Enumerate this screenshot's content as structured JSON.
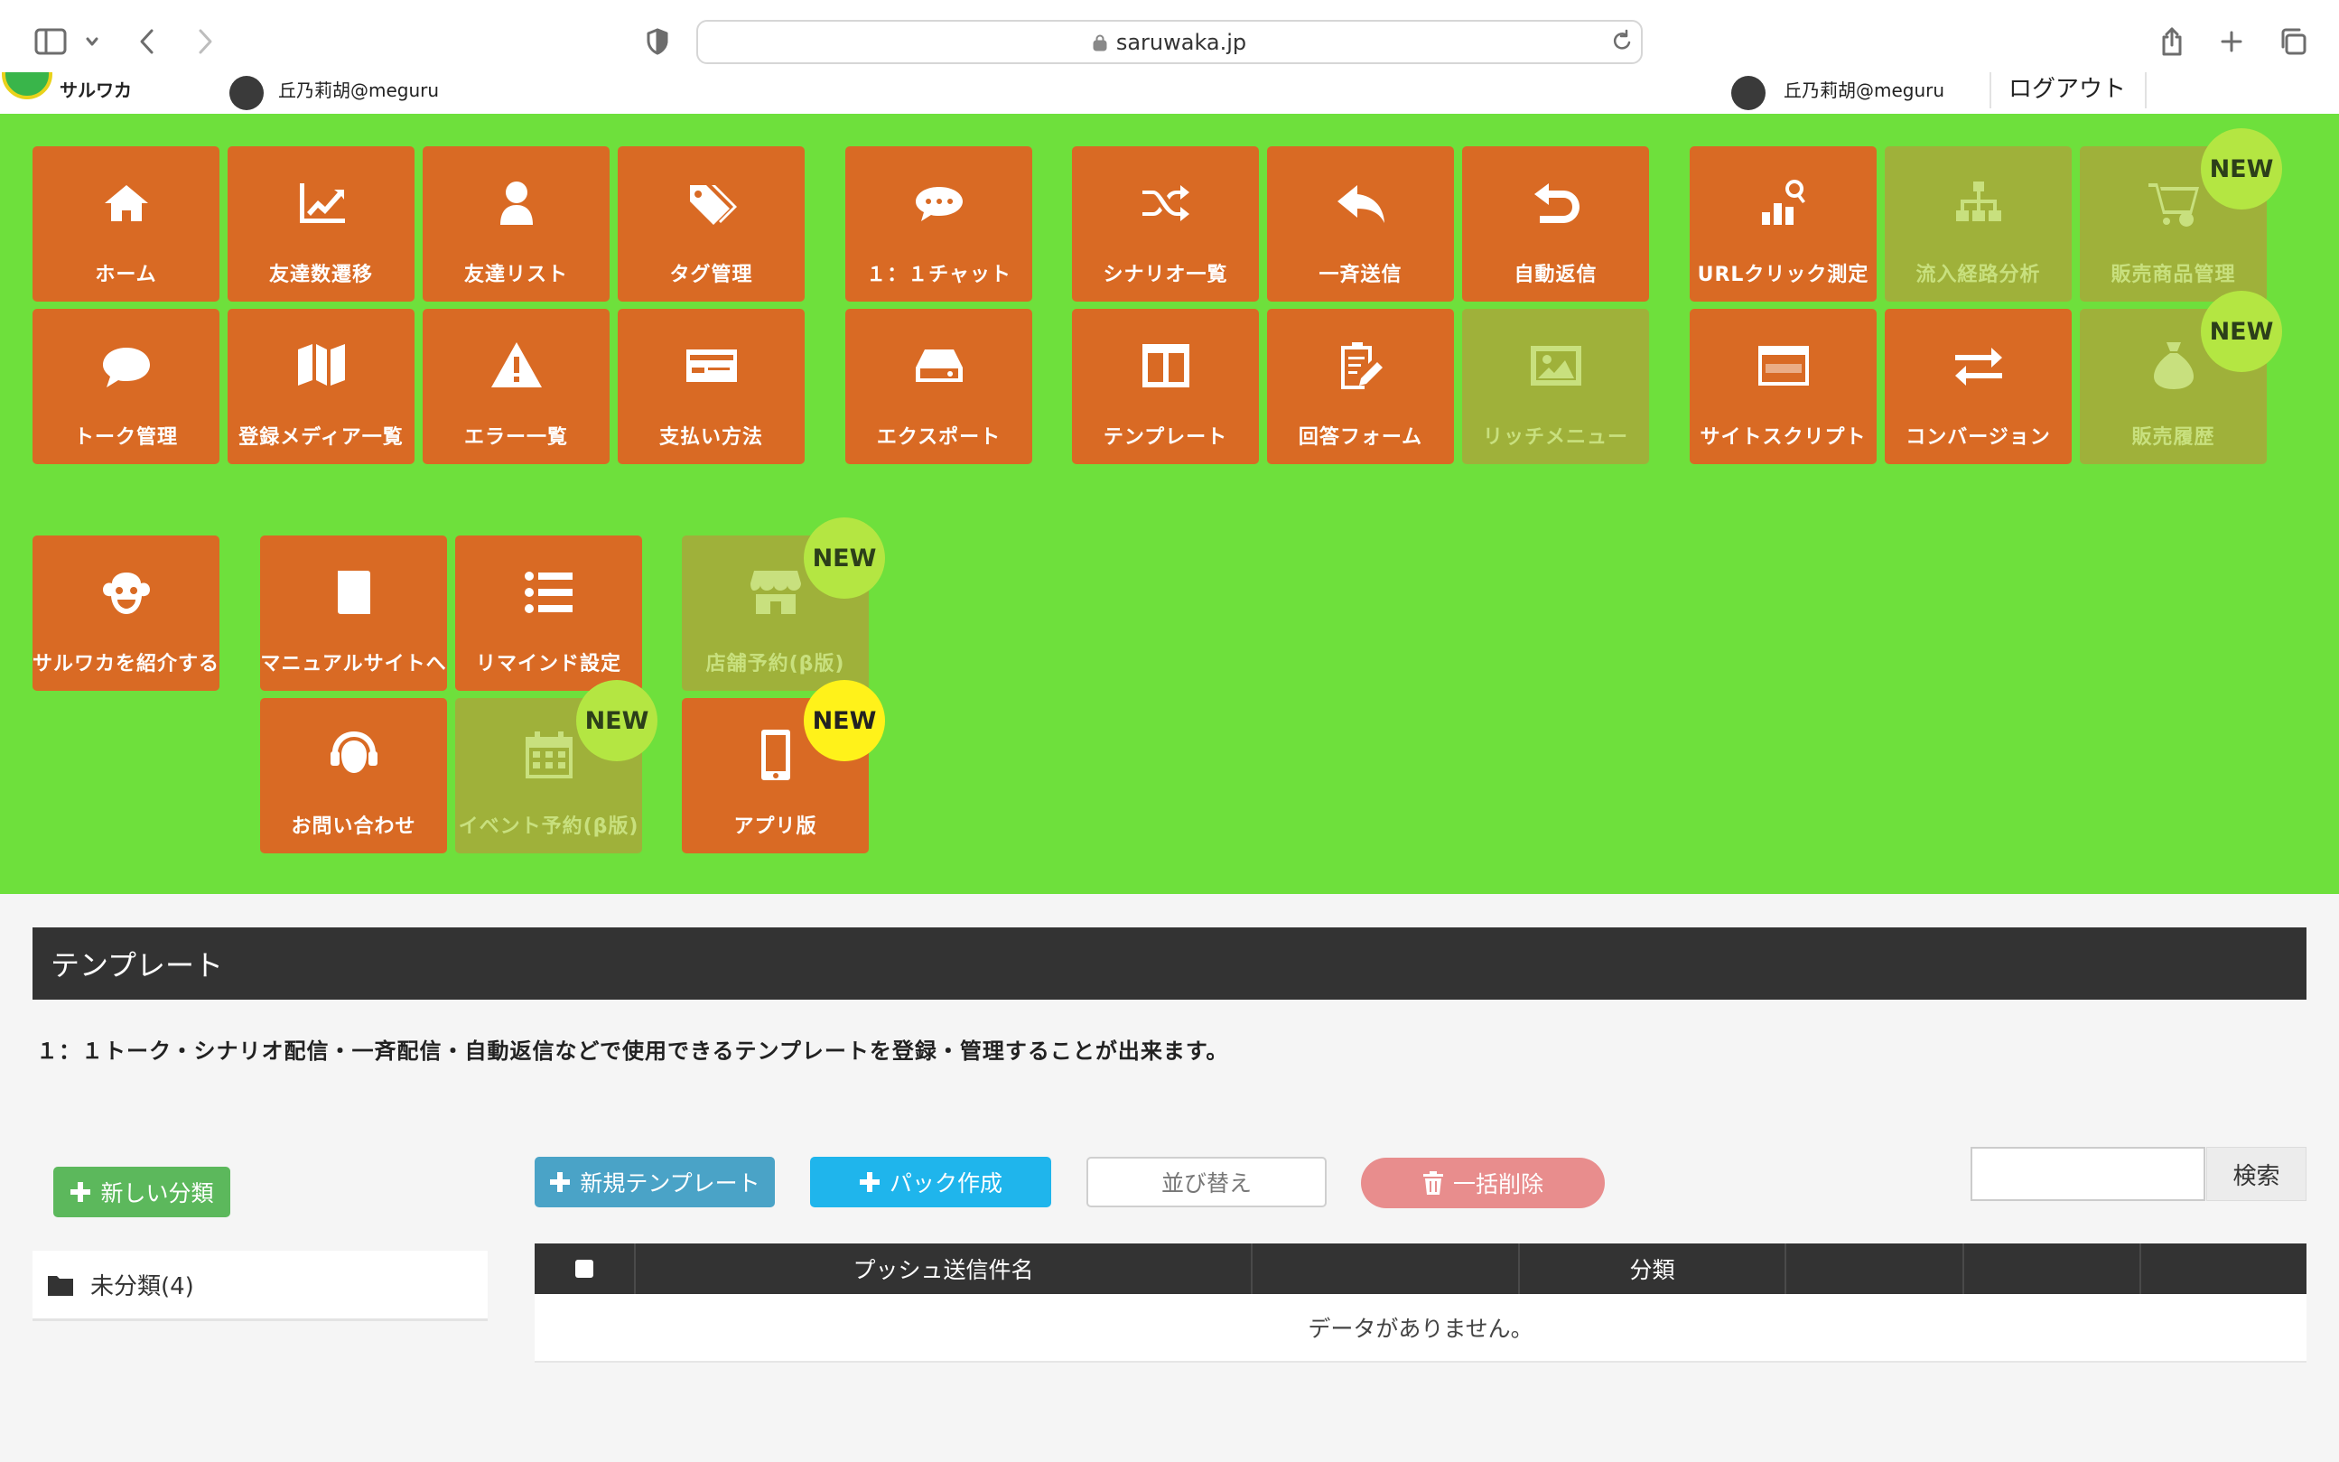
{
  "browser": {
    "url": "saruwaka.jp"
  },
  "site_header": {
    "left_user": "丘乃莉胡@meguru",
    "right_user": "丘乃莉胡@meguru",
    "logout": "ログアウト"
  },
  "menu": {
    "tiles": [
      {
        "id": "home",
        "label": "ホーム",
        "icon": "home-icon",
        "enabled": true
      },
      {
        "id": "friends-trend",
        "label": "友達数遷移",
        "icon": "line-chart-icon",
        "enabled": true
      },
      {
        "id": "friends-list",
        "label": "友達リスト",
        "icon": "user-icon",
        "enabled": true
      },
      {
        "id": "tags",
        "label": "タグ管理",
        "icon": "tags-icon",
        "enabled": true
      },
      {
        "id": "chat",
        "label": "１：１チャット",
        "icon": "chat-bubble-icon",
        "enabled": true
      },
      {
        "id": "scenario",
        "label": "シナリオ一覧",
        "icon": "shuffle-icon",
        "enabled": true
      },
      {
        "id": "broadcast",
        "label": "一斉送信",
        "icon": "reply-icon",
        "enabled": true
      },
      {
        "id": "auto-reply",
        "label": "自動返信",
        "icon": "undo-icon",
        "enabled": true
      },
      {
        "id": "url-click",
        "label": "URLクリック測定",
        "icon": "bar-chart-search-icon",
        "enabled": true
      },
      {
        "id": "inflow",
        "label": "流入経路分析",
        "icon": "sitemap-icon",
        "enabled": false
      },
      {
        "id": "products",
        "label": "販売商品管理",
        "icon": "cart-icon",
        "enabled": false,
        "badge": "NEW"
      },
      {
        "id": "talk",
        "label": "トーク管理",
        "icon": "speech-bubble-icon",
        "enabled": true
      },
      {
        "id": "media",
        "label": "登録メディア一覧",
        "icon": "map-icon",
        "enabled": true
      },
      {
        "id": "errors",
        "label": "エラー一覧",
        "icon": "warning-icon",
        "enabled": true
      },
      {
        "id": "payment",
        "label": "支払い方法",
        "icon": "card-icon",
        "enabled": true
      },
      {
        "id": "export",
        "label": "エクスポート",
        "icon": "drive-icon",
        "enabled": true
      },
      {
        "id": "template",
        "label": "テンプレート",
        "icon": "columns-icon",
        "enabled": true
      },
      {
        "id": "form",
        "label": "回答フォーム",
        "icon": "clipboard-edit-icon",
        "enabled": true
      },
      {
        "id": "rich-menu",
        "label": "リッチメニュー",
        "icon": "image-icon",
        "enabled": false
      },
      {
        "id": "site-script",
        "label": "サイトスクリプト",
        "icon": "www-window-icon",
        "enabled": true
      },
      {
        "id": "conversion",
        "label": "コンバージョン",
        "icon": "exchange-icon",
        "enabled": true
      },
      {
        "id": "sales-history",
        "label": "販売履歴",
        "icon": "money-bag-icon",
        "enabled": false,
        "badge": "NEW"
      },
      {
        "id": "refer",
        "label": "サルワカを紹介する",
        "icon": "monkey-icon",
        "enabled": true
      },
      {
        "id": "manual",
        "label": "マニュアルサイトへ",
        "icon": "book-icon",
        "enabled": true
      },
      {
        "id": "remind",
        "label": "リマインド設定",
        "icon": "list-icon",
        "enabled": true
      },
      {
        "id": "store-reserve",
        "label": "店舗予約(β版)",
        "icon": "store-icon",
        "enabled": false,
        "badge": "NEW"
      },
      {
        "id": "contact",
        "label": "お問い合わせ",
        "icon": "headset-icon",
        "enabled": true
      },
      {
        "id": "event-reserve",
        "label": "イベント予約(β版)",
        "icon": "calendar-icon",
        "enabled": false,
        "badge": "NEW"
      },
      {
        "id": "app",
        "label": "アプリ版",
        "icon": "smartphone-icon",
        "enabled": true,
        "badge": "NEW"
      }
    ]
  },
  "page": {
    "title": "テンプレート",
    "description": "１：１トーク・シナリオ配信・一斉配信・自動返信などで使用できるテンプレートを登録・管理することが出来ます。"
  },
  "sidebar": {
    "new_category_button": "新しい分類",
    "categories": [
      {
        "label": "未分類(4)",
        "icon": "folder-icon"
      }
    ]
  },
  "toolbar": {
    "new_template": "新規テンプレート",
    "create_pack": "パック作成",
    "sort": "並び替え",
    "delete_all": "一括削除",
    "search_placeholder": "",
    "search_button": "検索"
  },
  "table": {
    "columns": [
      "",
      "プッシュ送信件名",
      "",
      "分類",
      "",
      "",
      ""
    ],
    "empty_message": "データがありません。"
  },
  "colors": {
    "menu_bg": "#6ee03c",
    "tile": "#d96a24",
    "tile_disabled": "#9fb13a",
    "badge_green": "#b4e642",
    "badge_yellow": "#fff21a",
    "header_dark": "#333333"
  }
}
